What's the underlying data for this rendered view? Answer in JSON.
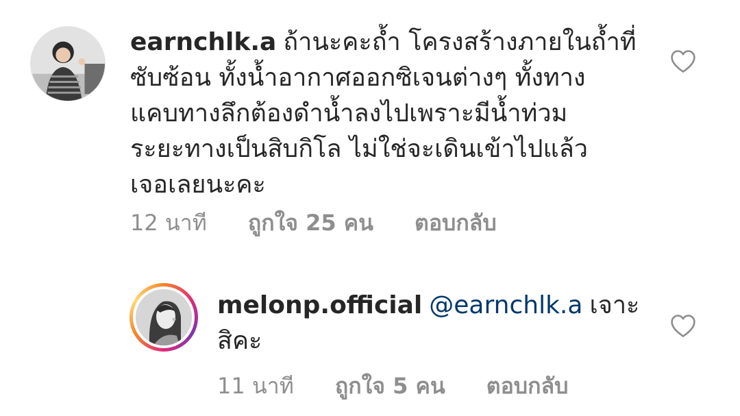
{
  "comments": [
    {
      "username": "earnchlk.a",
      "lines": [
        "ถ้านะคะถ้ำ โครงสร้างภายในถ้ำที่",
        "ซับซ้อน ทั้งน้ำอากาศออกซิเจนต่างๆ ทั้งทาง",
        "แคบทางลึกต้องดำน้ำลงไปเพราะมีน้ำท่วม",
        "ระยะทางเป็นสิบกิโล ไม่ใช่จะเดินเข้าไปแล้ว",
        "เจอเลยนะคะ"
      ],
      "time": "12 นาที",
      "likes": "ถูกใจ 25 คน",
      "reply": "ตอบกลับ",
      "like_icon": "heart-outline-icon"
    },
    {
      "username": "melonp.official",
      "mention": "@earnchlk.a",
      "lines": [
        "เจาะ",
        "สิคะ"
      ],
      "time": "11 นาที",
      "likes": "ถูกใจ 5 คน",
      "reply": "ตอบกลับ",
      "like_icon": "heart-outline-icon"
    }
  ],
  "colors": {
    "text": "#262626",
    "meta": "#8e8e8e",
    "mention": "#00376b",
    "story_ring": [
      "#f58529",
      "#dd2a7b",
      "#8134af",
      "#feda77"
    ]
  }
}
